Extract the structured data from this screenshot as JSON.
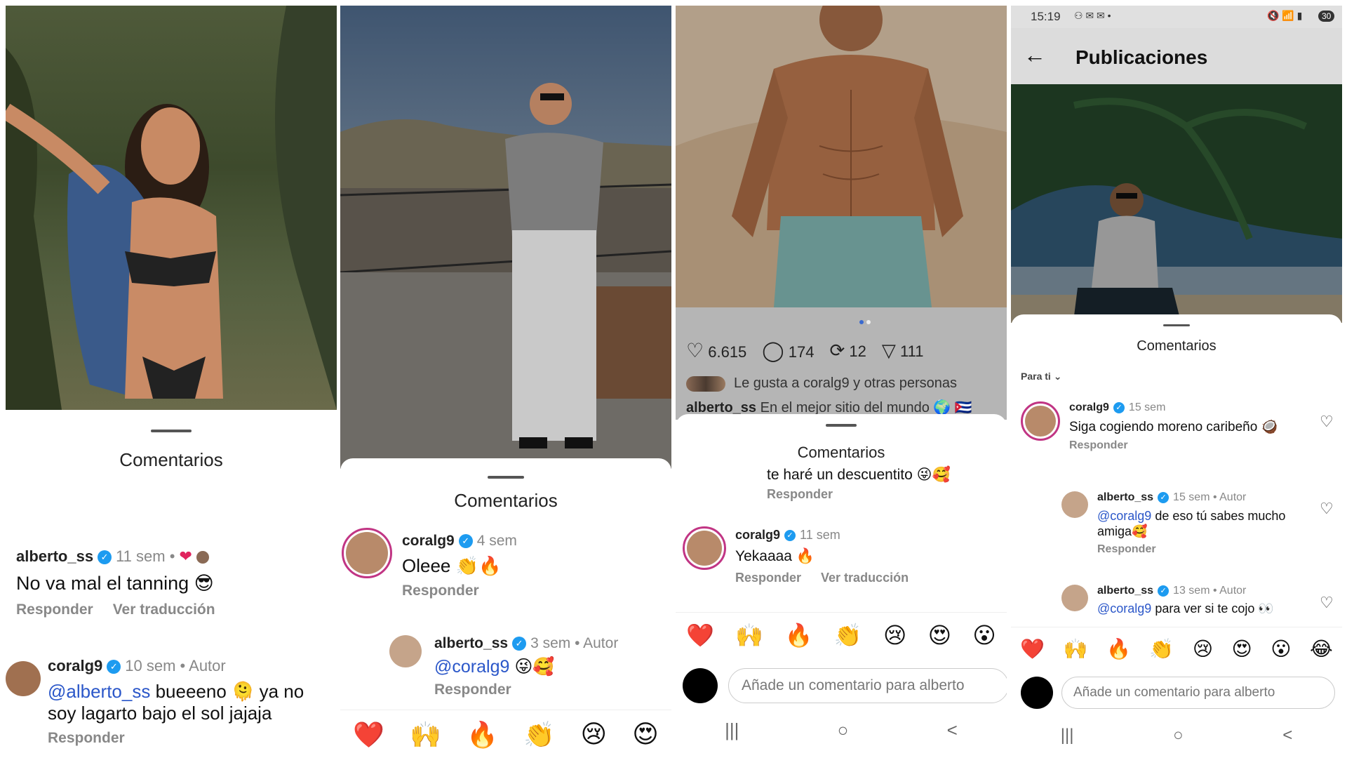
{
  "p1": {
    "sheet_title": "Comentarios",
    "c1": {
      "user": "alberto_ss",
      "time": "11 sem",
      "dot": "•",
      "text": "No va mal el tanning 😎",
      "reply": "Responder",
      "translate": "Ver traducción"
    },
    "c2": {
      "user": "coralg9",
      "time": "10 sem",
      "author": "• Autor",
      "mention": "@alberto_ss",
      "text": " bueeeno 🫠 ya no soy lagarto bajo el sol jajaja",
      "reply": "Responder"
    }
  },
  "p2": {
    "sheet_title": "Comentarios",
    "c1": {
      "user": "coralg9",
      "time": "4 sem",
      "text": "Oleee 👏🔥",
      "reply": "Responder"
    },
    "c2": {
      "user": "alberto_ss",
      "time": "3 sem",
      "author": "• Autor",
      "mention": "@coralg9",
      "text": " 😜🥰",
      "reply": "Responder"
    },
    "emojis": [
      "❤️",
      "🙌",
      "🔥",
      "👏",
      "😢",
      "😍"
    ]
  },
  "p3": {
    "likes": "6.615",
    "comments": "174",
    "reposts": "12",
    "shares": "111",
    "liked_by": "Le gusta a coralg9 y otras personas",
    "caption_user": "alberto_ss",
    "caption": " En el mejor sitio del mundo 🌍 🇨🇺",
    "sheet_title": "Comentarios",
    "prev_text": "te haré un descuentito 😜🥰",
    "prev_reply": "Responder",
    "c1": {
      "user": "coralg9",
      "time": "11 sem",
      "text": "Yekaaaa 🔥",
      "reply": "Responder",
      "translate": "Ver traducción"
    },
    "emojis": [
      "❤️",
      "🙌",
      "🔥",
      "👏",
      "😢",
      "😍",
      "😮"
    ],
    "input_placeholder": "Añade un comentario para alberto",
    "nav": [
      "|||",
      "○",
      "<"
    ]
  },
  "p4": {
    "status_time": "15:19",
    "status_icons": "⚇ ✉ ✉ •",
    "status_right": "🔇 📶 ▮",
    "battery": "30",
    "header_title": "Publicaciones",
    "sheet_title": "Comentarios",
    "filter": "Para ti",
    "c1": {
      "user": "coralg9",
      "time": "15 sem",
      "text": "Siga cogiendo moreno caribeño 🥥",
      "reply": "Responder"
    },
    "c2": {
      "user": "alberto_ss",
      "time": "15 sem • Autor",
      "mention": "@coralg9",
      "text": " de eso tú sabes mucho amiga🥰",
      "reply": "Responder"
    },
    "c3": {
      "user": "alberto_ss",
      "time": "13 sem • Autor",
      "mention": "@coralg9",
      "text": " para ver si te cojo 👀"
    },
    "emojis": [
      "❤️",
      "🙌",
      "🔥",
      "👏",
      "😢",
      "😍",
      "😮",
      "😂"
    ],
    "input_placeholder": "Añade un comentario para alberto",
    "nav": [
      "|||",
      "○",
      "<"
    ]
  }
}
